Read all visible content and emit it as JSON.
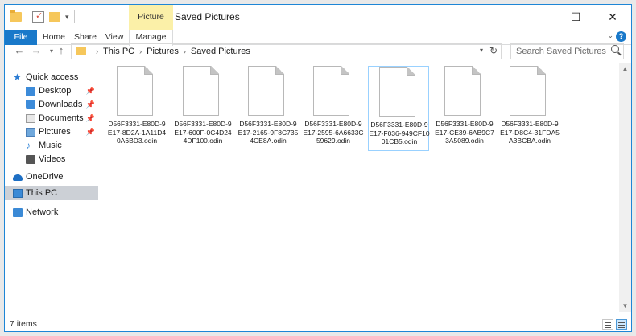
{
  "window": {
    "title": "Saved Pictures",
    "context_tab": "Picture Tools",
    "controls": {
      "minimize": "—",
      "maximize": "☐",
      "close": "✕"
    }
  },
  "ribbon": {
    "tabs": [
      "File",
      "Home",
      "Share",
      "View",
      "Manage"
    ]
  },
  "address": {
    "crumbs": [
      "This PC",
      "Pictures",
      "Saved Pictures"
    ],
    "search_placeholder": "Search Saved Pictures"
  },
  "nav": {
    "items": [
      {
        "label": "Quick access",
        "icon": "star-icon"
      },
      {
        "label": "Desktop",
        "icon": "desktop-icon",
        "pinned": true
      },
      {
        "label": "Downloads",
        "icon": "downloads-icon",
        "pinned": true
      },
      {
        "label": "Documents",
        "icon": "documents-icon",
        "pinned": true
      },
      {
        "label": "Pictures",
        "icon": "pictures-icon",
        "pinned": true
      },
      {
        "label": "Music",
        "icon": "music-icon"
      },
      {
        "label": "Videos",
        "icon": "videos-icon"
      },
      {
        "label": "OneDrive",
        "icon": "onedrive-icon"
      },
      {
        "label": "This PC",
        "icon": "this-pc-icon",
        "selected": true
      },
      {
        "label": "Network",
        "icon": "network-icon"
      }
    ]
  },
  "files": [
    {
      "name": "D56F3331-E80D-9E17-8D2A-1A11D40A6BD3.odin"
    },
    {
      "name": "D56F3331-E80D-9E17-600F-0C4D244DF100.odin"
    },
    {
      "name": "D56F3331-E80D-9E17-2165-9F8C7354CE8A.odin"
    },
    {
      "name": "D56F3331-E80D-9E17-2595-6A6633C59629.odin"
    },
    {
      "name": "D56F3331-E80D-9E17-F036-949CF1001CB5.odin",
      "focused": true
    },
    {
      "name": "D56F3331-E80D-9E17-CE39-6AB9C73A5089.odin"
    },
    {
      "name": "D56F3331-E80D-9E17-D8C4-31FDA5A3BCBA.odin"
    }
  ],
  "status": {
    "item_count": "7 items"
  },
  "colors": {
    "accent": "#1979ca",
    "tools_highlight": "#fbf0a8",
    "selected_nav": "#ccd0d6",
    "window_border": "#1e86d6"
  }
}
